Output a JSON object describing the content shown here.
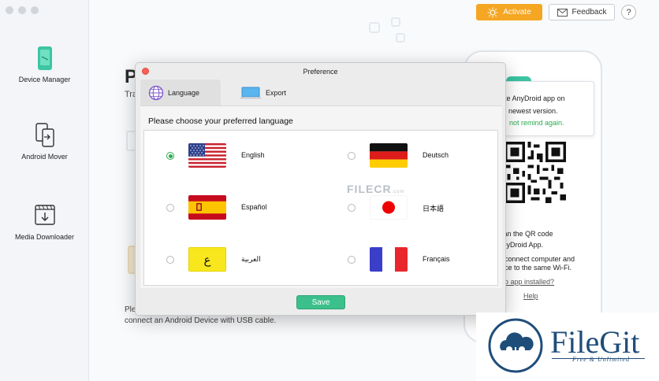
{
  "header": {
    "activate_label": "Activate",
    "feedback_label": "Feedback",
    "help_label": "?"
  },
  "sidebar": {
    "items": [
      {
        "label": "Device Manager",
        "icon": "phone-green-icon"
      },
      {
        "label": "Android Mover",
        "icon": "transfer-icon"
      },
      {
        "label": "Media Downloader",
        "icon": "download-icon"
      }
    ]
  },
  "background": {
    "title_fragment": "P",
    "subtitle_fragment": "Tra",
    "line1_fragment": "Ple",
    "line2": "connect an Android Device with USB cable."
  },
  "phone_panel": {
    "tooltip_line1": "update AnyDroid app on",
    "tooltip_line2": "to the newest version.",
    "tooltip_line3": "not remind again.",
    "scan_line1": "e scan the QR code",
    "scan_line2": "th AnyDroid App.",
    "wifi_line1": "connect computer and",
    "wifi_line2": "ce to the same Wi-Fi.",
    "no_app": "o app installed?",
    "help_link": "Help"
  },
  "dialog": {
    "title": "Preference",
    "tabs": [
      {
        "label": "Language",
        "icon": "globe-icon",
        "active": true
      },
      {
        "label": "Export",
        "icon": "laptop-icon",
        "active": false
      }
    ],
    "prompt": "Please choose your preferred language",
    "languages": [
      {
        "label": "English",
        "selected": true,
        "flag": "us-flag"
      },
      {
        "label": "Deutsch",
        "selected": false,
        "flag": "de-flag"
      },
      {
        "label": "Español",
        "selected": false,
        "flag": "es-flag"
      },
      {
        "label": "日本語",
        "selected": false,
        "flag": "jp-flag"
      },
      {
        "label": "العربية",
        "selected": false,
        "flag": "arabic-flag"
      },
      {
        "label": "Français",
        "selected": false,
        "flag": "fr-flag"
      }
    ],
    "arabic_flag_glyph": "ع",
    "save_label": "Save"
  },
  "watermarks": {
    "filecr_text": "FILECR",
    "filecr_suffix": ".com",
    "filegit_name": "FileGit",
    "filegit_tagline": "Free & Unlimited"
  },
  "colors": {
    "accent_green": "#3cc08b",
    "activate_orange": "#f5a623",
    "filegit_blue": "#1f4d7a"
  }
}
